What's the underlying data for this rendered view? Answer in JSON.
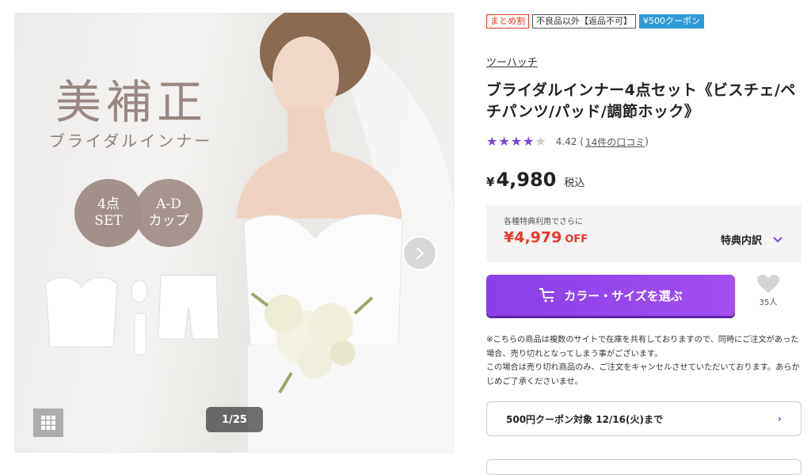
{
  "gallery": {
    "title": "美補正",
    "subtitle": "ブライダルインナー",
    "badge1_line1": "4点",
    "badge1_line2": "SET",
    "badge2_line1": "A-D",
    "badge2_line2": "カップ",
    "counter": "1/25"
  },
  "tags": [
    "まとめ割",
    "不良品以外【返品不可】",
    "¥500クーポン"
  ],
  "product": {
    "brand": "ツーハッチ",
    "title": "ブライダルインナー4点セット《ビスチェ/ペチパンツ/パッド/調節ホック》",
    "rating_value": 4.42,
    "rating_score": "4.42",
    "reviews": "14件の口コミ",
    "price_symbol": "¥",
    "price": "4,980",
    "tax": "税込"
  },
  "discount": {
    "label": "各種特典利用でさらに",
    "amount": "¥4,979",
    "off": "OFF",
    "detail": "特典内訳"
  },
  "cart": {
    "label": "カラー・サイズを選ぶ",
    "fav_count": "35人"
  },
  "notice": {
    "line1": "※こちらの商品は複数のサイトで在庫を共有しておりますので、同時にご注文があった場合、売り切れとなってしまう事がございます。",
    "line2": "この場合は売り切れ商品のみ、ご注文をキャンセルさせていただいております。あらかじめご了承くださいませ。"
  },
  "coupon": {
    "label": "500円クーポン対象 12/16(火)まで",
    "arrow": "›"
  },
  "colors": {
    "accent": "#8a3fe8",
    "sale": "#e8382a",
    "coupon_tag": "#2e9bd6"
  }
}
